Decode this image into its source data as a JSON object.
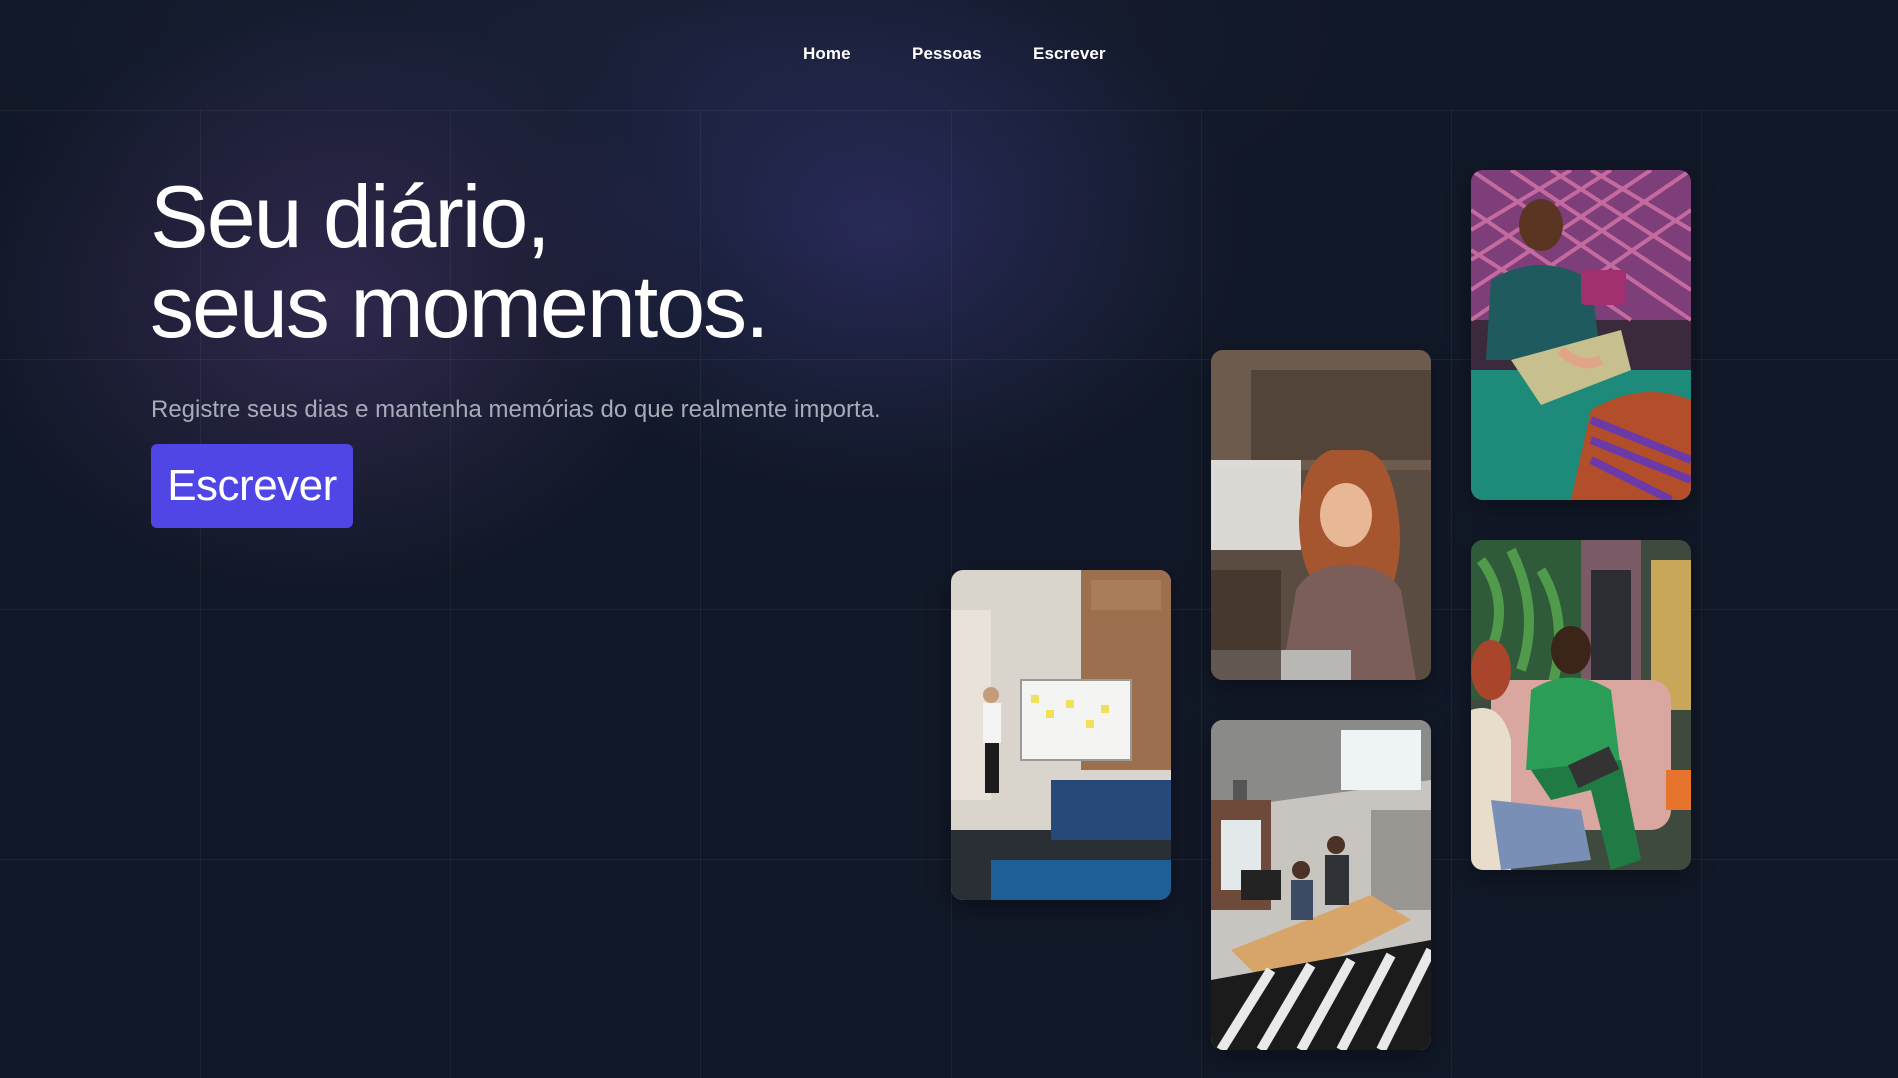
{
  "nav": {
    "items": [
      {
        "label": "Home"
      },
      {
        "label": "Pessoas"
      },
      {
        "label": "Escrever"
      }
    ]
  },
  "hero": {
    "title_line1": "Seu diário,",
    "title_line2": "seus momentos.",
    "subtitle": "Registre seus dias e mantenha memórias do que realmente importa.",
    "cta_label": "Escrever"
  },
  "colors": {
    "background": "#111827",
    "accent": "#4f46e5",
    "text": "#ffffff",
    "muted_text": "#a7acb9"
  }
}
